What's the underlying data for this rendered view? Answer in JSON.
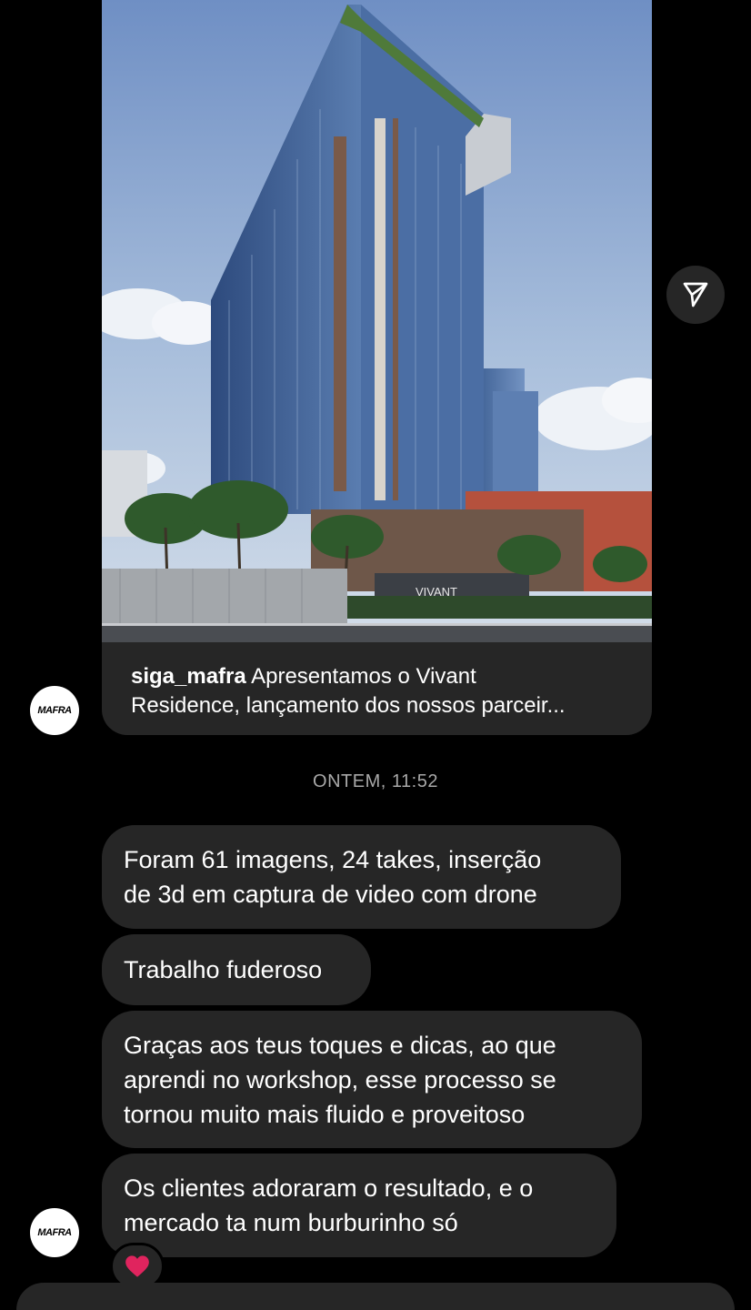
{
  "post": {
    "author": "siga_mafra",
    "caption_line1": "Apresentamos o Vivant",
    "caption_line2": "Residence, lançamento dos nossos parceir...",
    "sign_text": "VIVANT"
  },
  "avatar": {
    "logo_text": "MAFRA"
  },
  "icons": {
    "share": "paper-plane-icon",
    "reaction": "red-heart-icon"
  },
  "timestamp": "ONTEM, 11:52",
  "messages": [
    {
      "lines": [
        "Foram 61 imagens, 24 takes, inserção",
        "de 3d em captura de video com drone"
      ]
    },
    {
      "lines": [
        "Trabalho fuderoso"
      ]
    },
    {
      "lines": [
        "Graças aos teus toques e dicas, ao que",
        "aprendi no workshop, esse processo se",
        "tornou muito mais fluido e proveitoso"
      ]
    },
    {
      "lines": [
        "Os clientes adoraram o resultado, e o",
        "mercado ta num burburinho só"
      ]
    }
  ],
  "reaction": {
    "emoji": "❤️"
  },
  "colors": {
    "background": "#000000",
    "bubble": "#262626",
    "timestamp": "#a8a8a8",
    "heart": "#e0245e"
  }
}
